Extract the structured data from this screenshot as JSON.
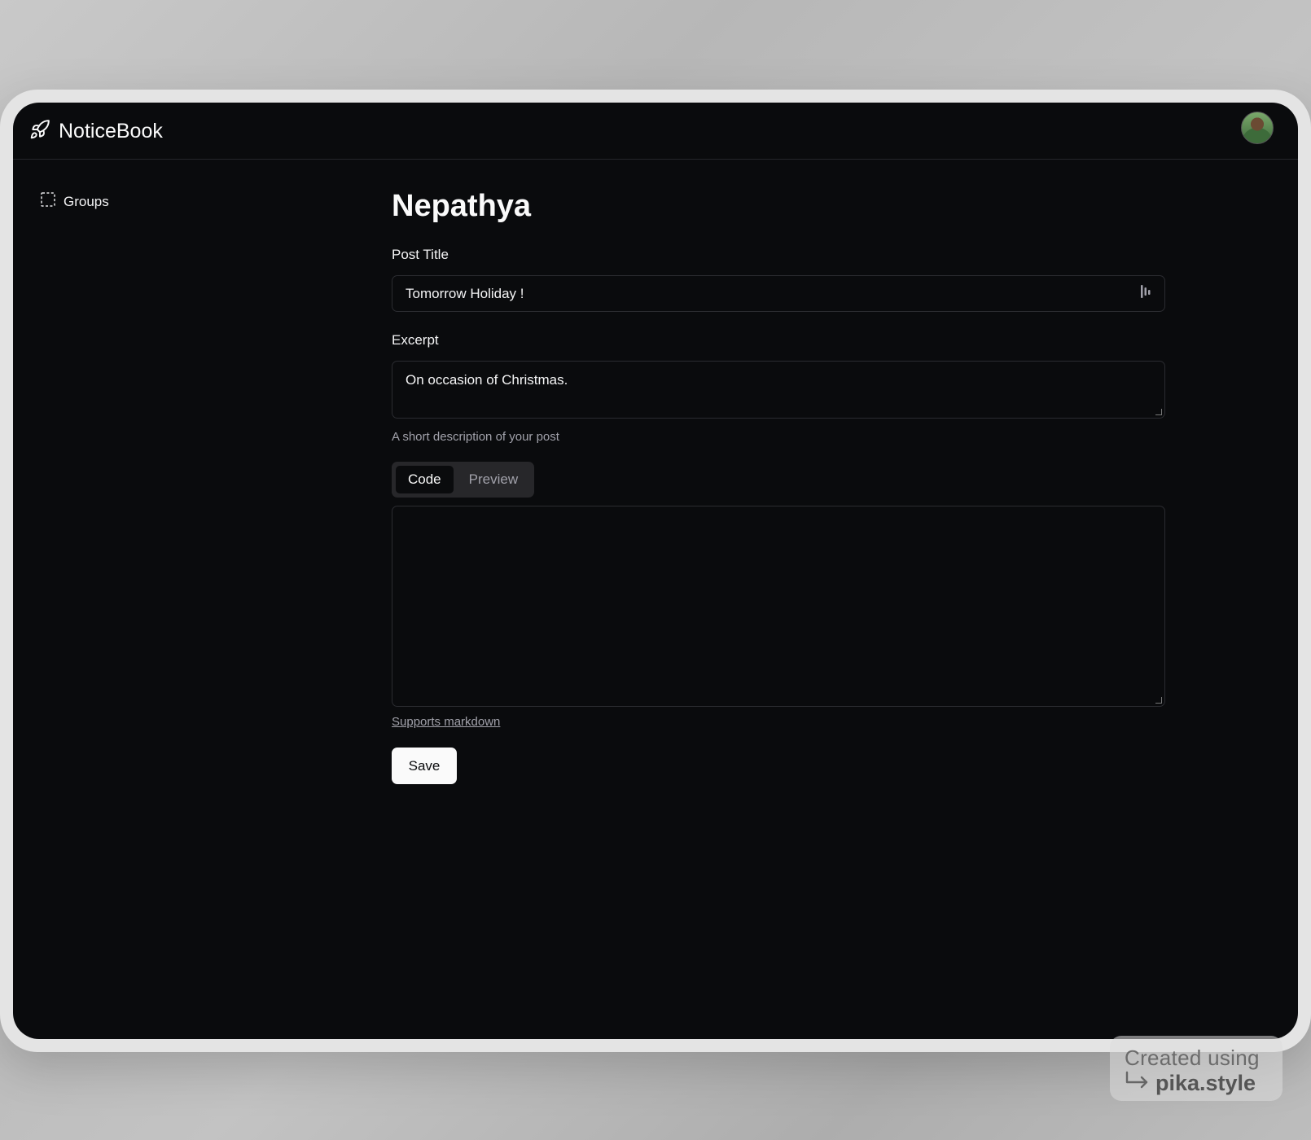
{
  "app": {
    "name": "NoticeBook"
  },
  "sidebar": {
    "items": [
      {
        "label": "Groups",
        "icon": "dashed-square-icon"
      }
    ]
  },
  "page": {
    "title": "Nepathya"
  },
  "form": {
    "post_title": {
      "label": "Post Title",
      "value": "Tomorrow Holiday !"
    },
    "excerpt": {
      "label": "Excerpt",
      "value": "On occasion of Christmas.",
      "hint": "A short description of your post"
    },
    "editor": {
      "tabs": [
        {
          "label": "Code",
          "active": true
        },
        {
          "label": "Preview",
          "active": false
        }
      ],
      "content": "",
      "markdown_note": "Supports markdown"
    },
    "save_label": "Save"
  },
  "watermark": {
    "line1": "Created using",
    "line2": "pika.style"
  },
  "colors": {
    "background": "#0a0b0d",
    "border": "#2b2c31",
    "text": "#f4f4f5",
    "muted": "#a1a1aa"
  }
}
